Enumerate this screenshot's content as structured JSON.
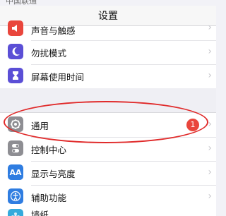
{
  "status_bar": {
    "text": "中国联通"
  },
  "nav": {
    "title": "设置"
  },
  "rows": {
    "sounds": {
      "label": "声音与触感",
      "icon": "speaker-icon",
      "color": "#e9463c"
    },
    "dnd": {
      "label": "勿扰模式",
      "icon": "moon-icon",
      "color": "#5b4fd6"
    },
    "screen_time": {
      "label": "屏幕使用时间",
      "icon": "hourglass-icon",
      "color": "#5b4fd6"
    },
    "general": {
      "label": "通用",
      "icon": "gear-icon",
      "color": "#8e8e93",
      "badge": "1"
    },
    "control_center": {
      "label": "控制中心",
      "icon": "toggle-icon",
      "color": "#8e8e93"
    },
    "display": {
      "label": "显示与亮度",
      "icon": "aa-icon",
      "color": "#2f7de1"
    },
    "accessibility": {
      "label": "辅助功能",
      "icon": "accessibility-icon",
      "color": "#2f7de1"
    },
    "wallpaper": {
      "label": "墙纸",
      "icon": "flower-icon",
      "color": "#35aadc"
    }
  },
  "chevron": "›"
}
